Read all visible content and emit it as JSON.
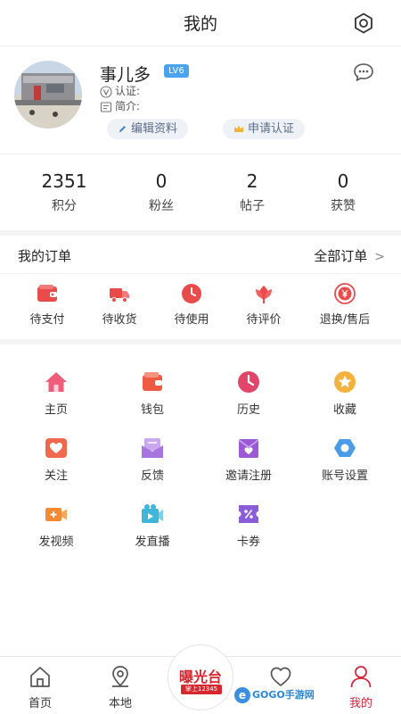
{
  "header": {
    "title": "我的",
    "settings_icon": "gear-icon"
  },
  "profile": {
    "username": "事儿多",
    "level": "LV6",
    "auth_label": "认证:",
    "intro_label": "简介:",
    "edit_button": "编辑资料",
    "certify_button": "申请认证",
    "message_icon": "chat-bubble-icon"
  },
  "stats": [
    {
      "value": "2351",
      "label": "积分"
    },
    {
      "value": "0",
      "label": "粉丝"
    },
    {
      "value": "2",
      "label": "帖子"
    },
    {
      "value": "0",
      "label": "获赞"
    }
  ],
  "orders": {
    "title": "我的订单",
    "all_link": "全部订单",
    "items": [
      {
        "label": "待支付",
        "icon": "wallet-icon",
        "color": "#e94b4b"
      },
      {
        "label": "待收货",
        "icon": "truck-icon",
        "color": "#e94b4b"
      },
      {
        "label": "待使用",
        "icon": "clock-icon",
        "color": "#e94b4b"
      },
      {
        "label": "待评价",
        "icon": "flower-icon",
        "color": "#e94b4b"
      },
      {
        "label": "退换/售后",
        "icon": "yen-refund-icon",
        "color": "#e94b4b"
      }
    ]
  },
  "grid": [
    {
      "label": "主页",
      "icon": "home-icon",
      "color": "#f05d7a"
    },
    {
      "label": "钱包",
      "icon": "wallet-icon",
      "color": "#ee5a43"
    },
    {
      "label": "历史",
      "icon": "clock-icon",
      "color": "#e2456a"
    },
    {
      "label": "收藏",
      "icon": "star-icon",
      "color": "#f3b23d"
    },
    {
      "label": "关注",
      "icon": "heart-icon",
      "color": "#f0684e"
    },
    {
      "label": "反馈",
      "icon": "mail-icon",
      "color": "#a775e0"
    },
    {
      "label": "邀请注册",
      "icon": "invite-icon",
      "color": "#9b59d6"
    },
    {
      "label": "账号设置",
      "icon": "settings-icon",
      "color": "#4a9be8"
    },
    {
      "label": "发视频",
      "icon": "video-icon",
      "color": "#f58a32"
    },
    {
      "label": "发直播",
      "icon": "live-icon",
      "color": "#3fb6d8"
    },
    {
      "label": "卡券",
      "icon": "coupon-icon",
      "color": "#8b5cd8"
    }
  ],
  "bottom_nav": {
    "items": [
      {
        "label": "首页",
        "icon": "home-outline-icon"
      },
      {
        "label": "本地",
        "icon": "location-icon"
      },
      {
        "label": "",
        "icon": "heart-outline-icon"
      },
      {
        "label": "我的",
        "icon": "user-icon"
      }
    ],
    "center_logo": "曝光台",
    "center_logo_sub": "掌上12345",
    "active_color": "#d7263d"
  },
  "watermark": "GOGO手游网"
}
